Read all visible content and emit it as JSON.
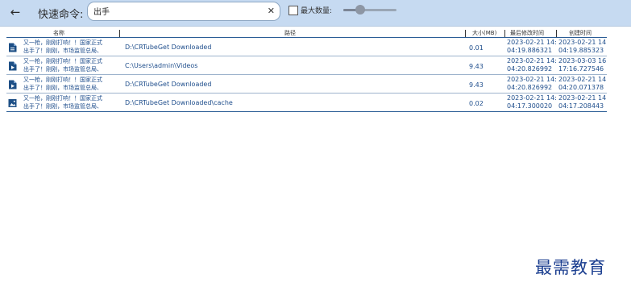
{
  "toolbar": {
    "command_label": "快速命令:",
    "search": {
      "value": "出手",
      "placeholder": ""
    },
    "max_count_label": "最大数量:",
    "max_count_checked": false,
    "slider_value_fraction": 0.25
  },
  "table": {
    "columns": {
      "name": "名称",
      "path": "路径",
      "size": "大小(MB)",
      "modified": "最后修改时间",
      "created": "创建时间"
    },
    "rows": [
      {
        "icon": "document-icon",
        "name_line1": "又一枪，刚刚打响！！国家正式",
        "name_line2": "出手了！刚刚，市场监管总局、",
        "path": "D:\\CRTubeGet Downloaded",
        "size": "0.01",
        "modified_line1": "2023-02-21 14:",
        "modified_line2": "04:19.886321",
        "created_line1": "2023-02-21 14",
        "created_line2": "04:19.885323"
      },
      {
        "icon": "video-file-icon",
        "name_line1": "又一枪，刚刚打响！！国家正式",
        "name_line2": "出手了！刚刚，市场监管总局、",
        "path": "C:\\Users\\admin\\Videos",
        "size": "9.43",
        "modified_line1": "2023-02-21 14:",
        "modified_line2": "04:20.826992",
        "created_line1": "2023-03-03 16",
        "created_line2": "17:16.727546"
      },
      {
        "icon": "video-file-icon",
        "name_line1": "又一枪，刚刚打响！！国家正式",
        "name_line2": "出手了！刚刚，市场监管总局、",
        "path": "D:\\CRTubeGet Downloaded",
        "size": "9.43",
        "modified_line1": "2023-02-21 14:",
        "modified_line2": "04:20.826992",
        "created_line1": "2023-02-21 14",
        "created_line2": "04:20.071378"
      },
      {
        "icon": "image-file-icon",
        "name_line1": "又一枪，刚刚打响！！国家正式",
        "name_line2": "出手了！刚刚，市场监管总局、",
        "path": "D:\\CRTubeGet Downloaded\\cache",
        "size": "0.02",
        "modified_line1": "2023-02-21 14:",
        "modified_line2": "04:17.300020",
        "created_line1": "2023-02-21 14",
        "created_line2": "04:17.208443"
      }
    ]
  },
  "watermark": "最需教育",
  "colors": {
    "toolbar_bg": "#c6daf1",
    "row_text": "#1f4e8c",
    "rule": "#2b5d96",
    "icon": "#1d4f86"
  }
}
